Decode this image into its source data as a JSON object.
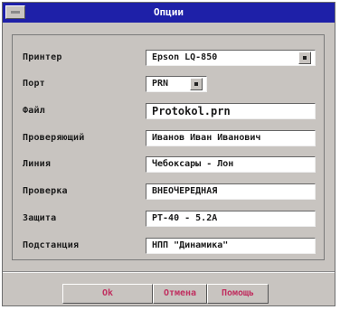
{
  "window": {
    "title": "Опции"
  },
  "form": {
    "rows": [
      {
        "label": "Принтер",
        "value": "Epson LQ-850"
      },
      {
        "label": "Порт",
        "value": "PRN"
      },
      {
        "label": "Файл",
        "value": "Protokol.prn"
      },
      {
        "label": "Проверяющий",
        "value": "Иванов Иван Иванович"
      },
      {
        "label": "Линия",
        "value": "Чебоксары - Лон"
      },
      {
        "label": "Проверка",
        "value": "ВНЕОЧЕРЕДНАЯ"
      },
      {
        "label": "Защита",
        "value": "РТ-40 - 5.2А"
      },
      {
        "label": "Подстанция",
        "value": "НПП \"Динамика\""
      }
    ]
  },
  "buttons": {
    "ok": "Ok",
    "cancel": "Отмена",
    "help": "Помощь"
  },
  "icons": {
    "system_menu": "system-menu-icon",
    "dropdown": "dropdown-arrow-icon"
  },
  "colors": {
    "titlebar": "#1e20a8",
    "window_bg": "#c8c4c0",
    "button_text": "#c03060"
  }
}
